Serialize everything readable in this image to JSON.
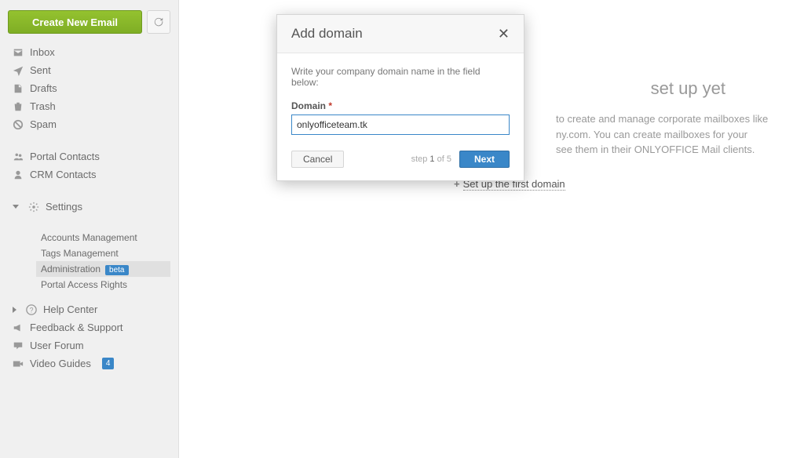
{
  "sidebar": {
    "create_button": "Create New Email",
    "nav": {
      "inbox": "Inbox",
      "sent": "Sent",
      "drafts": "Drafts",
      "trash": "Trash",
      "spam": "Spam"
    },
    "contacts": {
      "portal": "Portal Contacts",
      "crm": "CRM Contacts"
    },
    "settings": {
      "label": "Settings",
      "accounts": "Accounts Management",
      "tags": "Tags Management",
      "admin": "Administration",
      "admin_badge": "beta",
      "rights": "Portal Access Rights"
    },
    "help": {
      "label": "Help Center",
      "feedback": "Feedback & Support",
      "forum": "User Forum",
      "video": "Video Guides",
      "video_count": "4"
    }
  },
  "main": {
    "heading_tail": "set up yet",
    "desc_tail_1": "to create and manage corporate mailboxes like",
    "desc_tail_2": "ny.com. You can create mailboxes for your",
    "desc_tail_3": "see them in their ONLYOFFICE Mail clients.",
    "setup_link": "Set up the first domain"
  },
  "modal": {
    "title": "Add domain",
    "instruction": "Write your company domain name in the field below:",
    "field_label": "Domain",
    "input_value": "onlyofficeteam.tk",
    "cancel": "Cancel",
    "step_word": "step",
    "step_cur": "1",
    "step_of": "of",
    "step_total": "5",
    "next": "Next"
  }
}
